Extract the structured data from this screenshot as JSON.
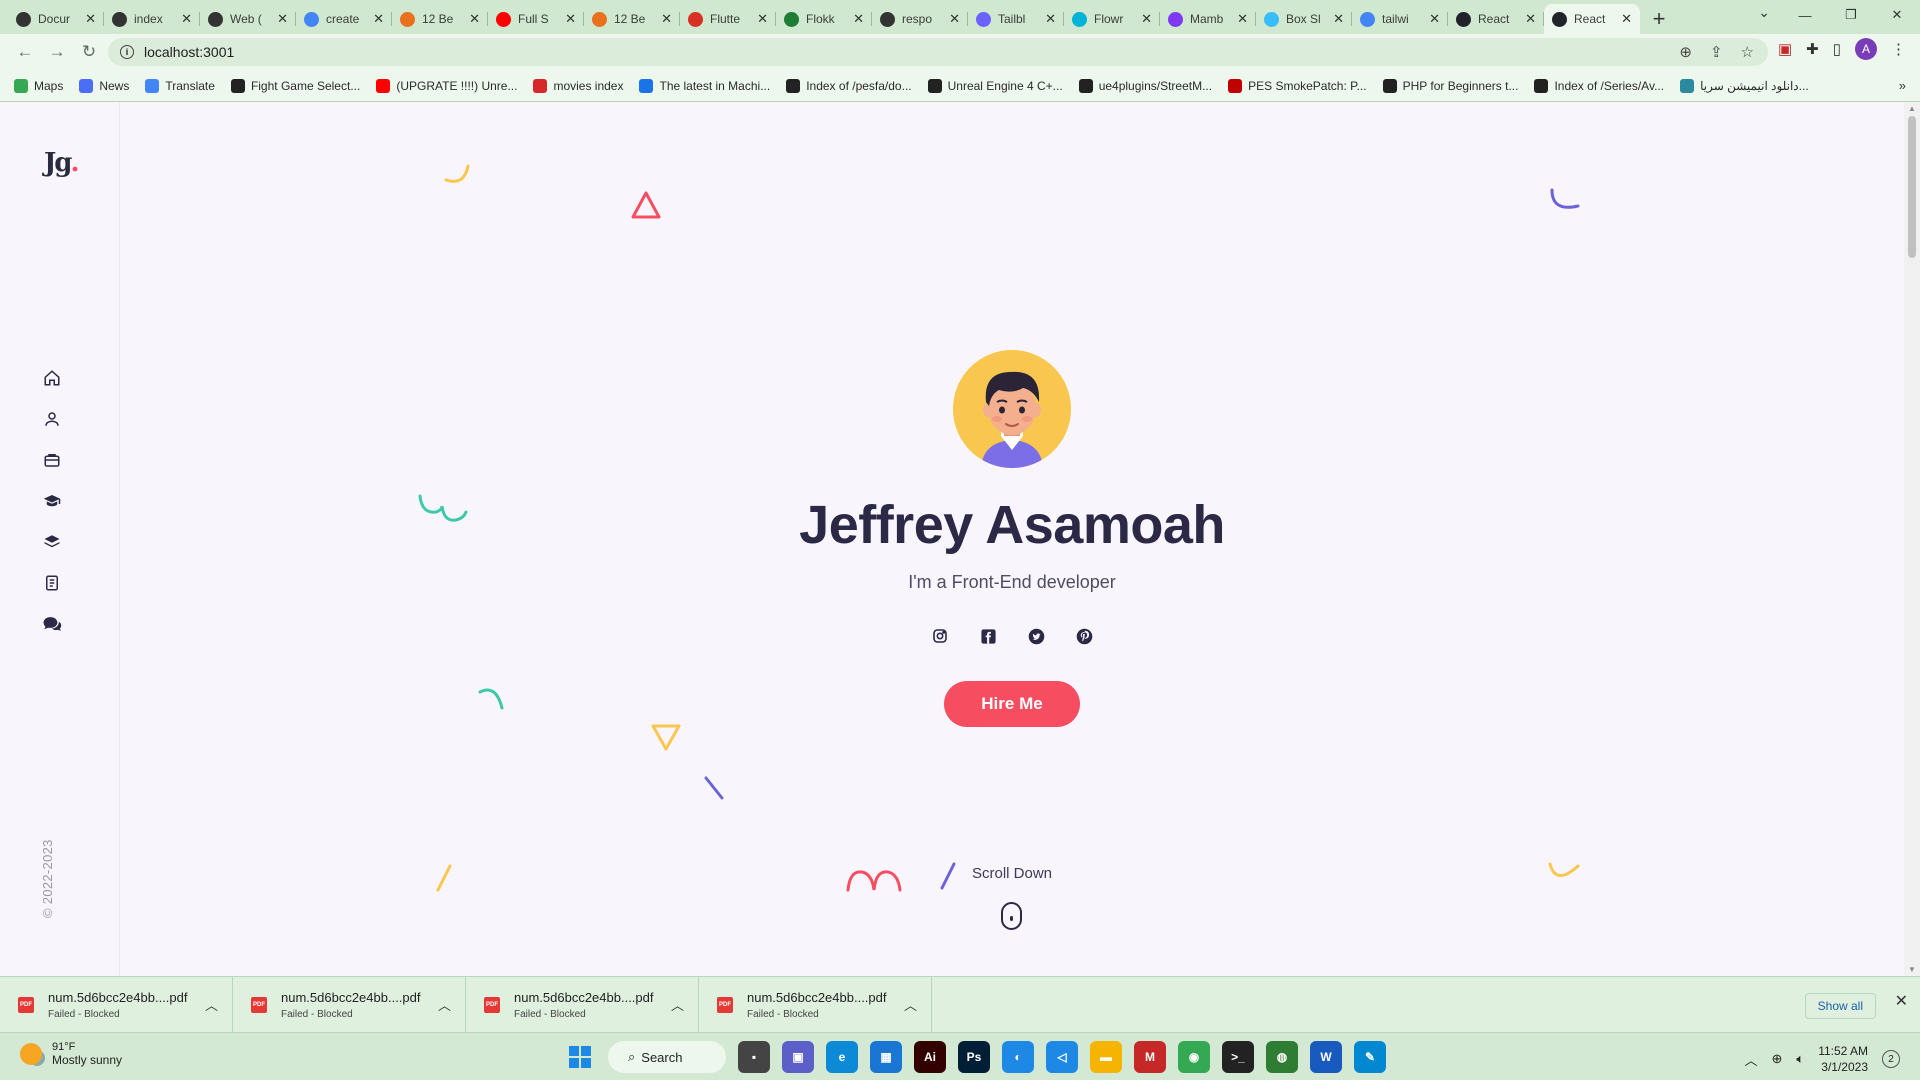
{
  "browser": {
    "tabs": [
      {
        "title": "Docur",
        "icon": "globe-icon",
        "color": "#333333"
      },
      {
        "title": "index",
        "icon": "globe-icon",
        "color": "#333333"
      },
      {
        "title": "Web (",
        "icon": "globe-icon",
        "color": "#333333"
      },
      {
        "title": "create",
        "icon": "google-icon",
        "color": "#4285f4"
      },
      {
        "title": "12 Be",
        "icon": "diamond-icon",
        "color": "#e8711c"
      },
      {
        "title": "Full S",
        "icon": "youtube-icon",
        "color": "#ff0000"
      },
      {
        "title": "12 Be",
        "icon": "diamond-icon",
        "color": "#e8711c"
      },
      {
        "title": "Flutte",
        "icon": "pdf-icon",
        "color": "#d93025"
      },
      {
        "title": "Flokk",
        "icon": "flokk-icon",
        "color": "#1e7e34"
      },
      {
        "title": "respo",
        "icon": "globe-icon",
        "color": "#333333"
      },
      {
        "title": "Tailbl",
        "icon": "tailblocks-icon",
        "color": "#6c63ff"
      },
      {
        "title": "Flowr",
        "icon": "flowbite-icon",
        "color": "#00b4d8"
      },
      {
        "title": "Mamb",
        "icon": "mamba-icon",
        "color": "#7e3af2"
      },
      {
        "title": "Box Sl",
        "icon": "tailwind-icon",
        "color": "#38bdf8"
      },
      {
        "title": "tailwi",
        "icon": "google-icon",
        "color": "#4285f4"
      },
      {
        "title": "React",
        "icon": "react-icon",
        "color": "#20232a"
      },
      {
        "title": "React",
        "icon": "react-icon",
        "color": "#20232a",
        "active": true
      }
    ],
    "url": "localhost:3001",
    "bookmarks": [
      {
        "label": "Maps",
        "icon": "maps-icon",
        "color": "#34a853"
      },
      {
        "label": "News",
        "icon": "news-icon",
        "color": "#4c6ef5"
      },
      {
        "label": "Translate",
        "icon": "translate-icon",
        "color": "#4285f4"
      },
      {
        "label": "Fight Game Select...",
        "icon": "ue-icon",
        "color": "#222222"
      },
      {
        "label": "(UPGRATE !!!!) Unre...",
        "icon": "youtube-icon",
        "color": "#ff0000"
      },
      {
        "label": "movies index",
        "icon": "drop-icon",
        "color": "#d62828"
      },
      {
        "label": "The latest in Machi...",
        "icon": "paper-icon",
        "color": "#1a73e8"
      },
      {
        "label": "Index of /pesfa/do...",
        "icon": "globe-icon",
        "color": "#222222"
      },
      {
        "label": "Unreal Engine 4 C+...",
        "icon": "ue-icon",
        "color": "#222222"
      },
      {
        "label": "ue4plugins/StreetM...",
        "icon": "github-icon",
        "color": "#222222"
      },
      {
        "label": "PES SmokePatch: P...",
        "icon": "sp-icon",
        "color": "#c00000"
      },
      {
        "label": "PHP for Beginners t...",
        "icon": "globe-icon",
        "color": "#222222"
      },
      {
        "label": "Index of /Series/Av...",
        "icon": "globe-icon",
        "color": "#222222"
      },
      {
        "label": "دانلود انیمیشن سریا...",
        "icon": "anime-icon",
        "color": "#2b8a9e"
      }
    ]
  },
  "site": {
    "logo": "Jg",
    "copyright": "© 2022-2023",
    "nav": [
      "home-icon",
      "user-icon",
      "briefcase-icon",
      "graduation-cap-icon",
      "layers-icon",
      "document-icon",
      "chat-icon"
    ],
    "name": "Jeffrey Asamoah",
    "role": "I'm a Front-End developer",
    "socials": [
      "instagram-icon",
      "facebook-icon",
      "twitter-icon",
      "pinterest-icon"
    ],
    "hire_label": "Hire Me",
    "scroll_label": "Scroll Down",
    "accent": "#f64e60"
  },
  "downloads": {
    "items": [
      {
        "name": "num.5d6bcc2e4bb....pdf",
        "status": "Failed - Blocked"
      },
      {
        "name": "num.5d6bcc2e4bb....pdf",
        "status": "Failed - Blocked"
      },
      {
        "name": "num.5d6bcc2e4bb....pdf",
        "status": "Failed - Blocked"
      },
      {
        "name": "num.5d6bcc2e4bb....pdf",
        "status": "Failed - Blocked"
      }
    ],
    "show_all": "Show all"
  },
  "taskbar": {
    "temp": "91°F",
    "weather": "Mostly sunny",
    "search_label": "Search",
    "time": "11:52 AM",
    "date": "3/1/2023",
    "notifications": "2",
    "apps": [
      {
        "name": "file-explorer-icon",
        "color": "#444444",
        "glyph": "▪"
      },
      {
        "name": "teams-icon",
        "color": "#5b5fc7",
        "glyph": "▣"
      },
      {
        "name": "edge-icon",
        "color": "#0c8ad6",
        "glyph": "e"
      },
      {
        "name": "store-icon",
        "color": "#1976d2",
        "glyph": "▦"
      },
      {
        "name": "illustrator-icon",
        "color": "#330000",
        "glyph": "Ai"
      },
      {
        "name": "photoshop-icon",
        "color": "#001e36",
        "glyph": "Ps"
      },
      {
        "name": "blender-icon",
        "color": "#1e88e5",
        "glyph": "◐"
      },
      {
        "name": "vscode-icon",
        "color": "#1e88e5",
        "glyph": "◁"
      },
      {
        "name": "folder-icon",
        "color": "#f5b400",
        "glyph": "▬"
      },
      {
        "name": "mamp-icon",
        "color": "#c62828",
        "glyph": "M"
      },
      {
        "name": "chrome-icon",
        "color": "#34a853",
        "glyph": "◉"
      },
      {
        "name": "terminal-icon",
        "color": "#222222",
        "glyph": ">_"
      },
      {
        "name": "globe-app-icon",
        "color": "#2e7d32",
        "glyph": "◍"
      },
      {
        "name": "word-icon",
        "color": "#185abd",
        "glyph": "W"
      },
      {
        "name": "paint-icon",
        "color": "#0288d1",
        "glyph": "✎"
      }
    ]
  }
}
